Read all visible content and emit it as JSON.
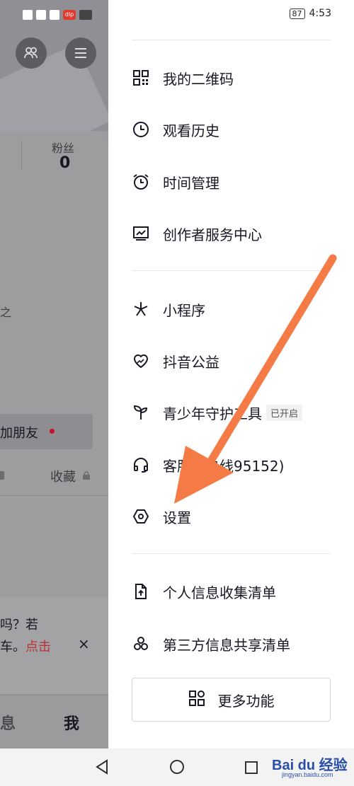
{
  "status_bar": {
    "battery": "87",
    "time": "4:53",
    "app_icon_text": "dlp"
  },
  "background_profile": {
    "fans_label": "粉丝",
    "fans_count": "0",
    "fragment_text": "之",
    "add_friend_label": "加朋友",
    "favorites_label": "收藏",
    "banner_line1": "吗？若",
    "banner_line2_prefix": "车。",
    "banner_line2_link": "点击",
    "banner_close": "×",
    "tab_messages": "消息",
    "tab_me": "我"
  },
  "drawer": {
    "group1": [
      {
        "label": "我的二维码",
        "icon": "qrcode-icon"
      },
      {
        "label": "观看历史",
        "icon": "clock-icon"
      },
      {
        "label": "时间管理",
        "icon": "alarm-icon"
      },
      {
        "label": "创作者服务中心",
        "icon": "creator-chart-icon"
      }
    ],
    "group2": [
      {
        "label": "小程序",
        "icon": "mini-program-icon"
      },
      {
        "label": "抖音公益",
        "icon": "charity-heart-icon"
      },
      {
        "label": "青少年守护工具",
        "icon": "sprout-icon",
        "badge": "已开启"
      },
      {
        "label": "客服（热线95152)",
        "icon": "headset-icon"
      },
      {
        "label": "设置",
        "icon": "settings-hexagon-icon"
      }
    ],
    "group3": [
      {
        "label": "个人信息收集清单",
        "icon": "document-icon"
      },
      {
        "label": "第三方信息共享清单",
        "icon": "share-circles-icon"
      }
    ],
    "more_button": "更多功能"
  },
  "watermark": {
    "text": "Bai du 经验",
    "sub": "jingyan.baidu.com"
  },
  "colors": {
    "arrow": "#f47b45",
    "accent_red": "#c8102e",
    "dim_overlay": "#9a9a9e"
  }
}
